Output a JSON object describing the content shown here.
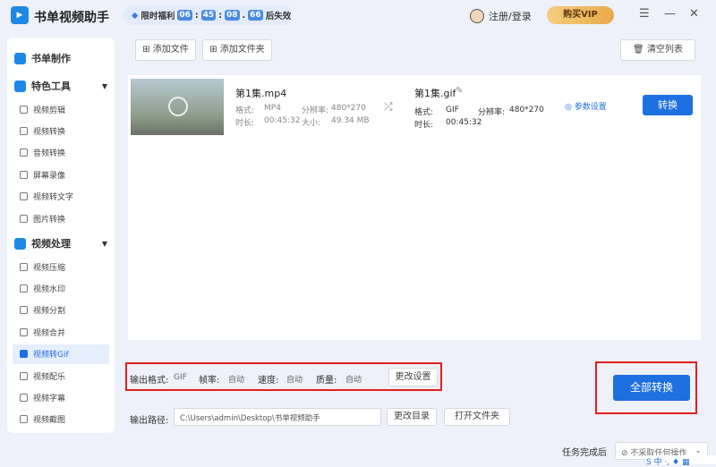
{
  "app": {
    "title": "书单视频助手",
    "logo_icon": "play-icon"
  },
  "promo": {
    "label": "限时福利",
    "h": "06",
    "m": "45",
    "s": "08",
    "ms": "66",
    "suffix": "后失效"
  },
  "header": {
    "login": "注册/登录",
    "vip": "购买VIP"
  },
  "toolbar": {
    "add_file": "添加文件",
    "add_folder": "添加文件夹",
    "clear": "清空列表"
  },
  "sidebar": {
    "sec1": "书单制作",
    "sec2": "特色工具",
    "sec3": "视频处理",
    "tools": [
      "视频剪辑",
      "视频转换",
      "音频转换",
      "屏幕录像",
      "视频转文字",
      "图片转换"
    ],
    "video": [
      "视频压缩",
      "视频水印",
      "视频分割",
      "视频合并",
      "视频转Gif",
      "视频配乐",
      "视频字幕",
      "视频截图"
    ]
  },
  "file": {
    "name": "第1集.mp4",
    "format_label": "格式:",
    "format": "MP4",
    "res_label": "分辨率:",
    "res": "480*270",
    "dur_label": "时长:",
    "dur": "00:45:32",
    "size_label": "大小:",
    "size": "49.34 MB",
    "out_name": "第1集.gif",
    "out_format_label": "格式:",
    "out_format": "GIF",
    "out_res_label": "分辨率:",
    "out_res": "480*270",
    "out_dur_label": "时长:",
    "out_dur": "00:45:32",
    "params": "参数设置",
    "convert": "转换"
  },
  "output": {
    "format_label": "输出格式:",
    "format": "GIF",
    "fps_label": "帧率:",
    "fps": "自动",
    "speed_label": "速度:",
    "speed": "自动",
    "quality_label": "质量:",
    "quality": "自动",
    "change": "更改设置",
    "path_label": "输出路径:",
    "path": "C:\\Users\\admin\\Desktop\\书单视频助手",
    "change_dir": "更改目录",
    "open_folder": "打开文件夹",
    "convert_all": "全部转换"
  },
  "footer": {
    "after_label": "任务完成后",
    "after_value": "不采取任何操作"
  },
  "ime": {
    "text": "S 中 ·, ♦ ▦"
  },
  "colors": {
    "accent": "#1e6fe0",
    "highlight": "#e02020"
  }
}
